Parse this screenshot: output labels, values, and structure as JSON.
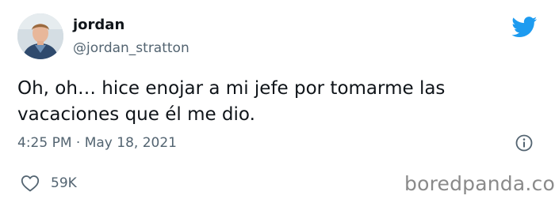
{
  "user": {
    "display_name": "jordan",
    "handle": "@jordan_stratton"
  },
  "tweet": {
    "text": "Oh, oh… hice enojar a mi jefe por tomarme las\nvacaciones que él me dio.",
    "timestamp": "4:25 PM · May 18, 2021"
  },
  "engagement": {
    "likes": "59K"
  },
  "watermark": "boredpanda.com",
  "icons": {
    "brand": "twitter-bird-icon",
    "info": "info-icon",
    "like": "heart-icon"
  },
  "colors": {
    "twitter_blue": "#1d9bf0",
    "secondary_text": "#536471",
    "primary_text": "#0f1419",
    "watermark": "#8a8a8a"
  }
}
